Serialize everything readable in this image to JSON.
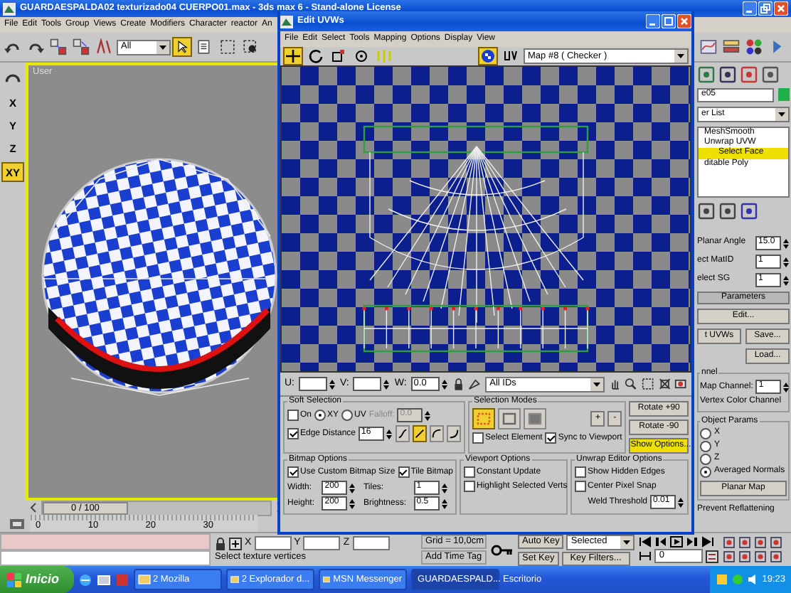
{
  "window": {
    "title": "GUARDAESPALDA02 texturizado04 CUERPO01.max - 3ds max 6 - Stand-alone License"
  },
  "menu": [
    "File",
    "Edit",
    "Tools",
    "Group",
    "Views",
    "Create",
    "Modifiers",
    "Character",
    "reactor",
    "An"
  ],
  "toolbar": {
    "selection_filter": "All",
    "select_tool": {
      "selected": true
    }
  },
  "axis_buttons": [
    {
      "label": "X",
      "selected": false
    },
    {
      "label": "Y",
      "selected": false
    },
    {
      "label": "Z",
      "selected": false
    },
    {
      "label": "XY",
      "selected": true
    }
  ],
  "viewport": {
    "label": "User"
  },
  "uvw_editor": {
    "title": "Edit UVWs",
    "menu": [
      "File",
      "Edit",
      "Select",
      "Tools",
      "Mapping",
      "Options",
      "Display",
      "View"
    ],
    "tools": [
      {
        "kind": "move",
        "selected": true
      },
      {
        "kind": "rotate",
        "selected": false
      },
      {
        "kind": "scale",
        "selected": false
      },
      {
        "kind": "freeform",
        "selected": false
      },
      {
        "kind": "mirror",
        "selected": false
      }
    ],
    "map": "Map #8 ( Checker )",
    "coords": [
      {
        "label": "U:"
      },
      {
        "label": "V:"
      },
      {
        "label": "W:",
        "value": "0.0"
      }
    ],
    "id_filter": "All IDs",
    "soft_selection": {
      "title": "Soft Selection",
      "on": {
        "label": "On",
        "checked": false
      },
      "space": [
        {
          "label": "XY",
          "selected": true
        },
        {
          "label": "UV",
          "selected": false
        }
      ],
      "falloff": {
        "label": "Falloff:",
        "value": "0.0",
        "disabled": true
      },
      "edge_distance": {
        "label": "Edge Distance",
        "checked": true,
        "value": "16"
      },
      "falloff_types": [
        {
          "kind": "smooth",
          "selected": false
        },
        {
          "kind": "linear",
          "selected": true
        },
        {
          "kind": "slow",
          "selected": false
        },
        {
          "kind": "fast",
          "selected": false
        }
      ]
    },
    "selection_modes": {
      "title": "Selection Modes",
      "modes": [
        {
          "kind": "vertex",
          "selected": true
        },
        {
          "kind": "edge",
          "selected": false
        },
        {
          "kind": "face",
          "selected": false
        }
      ],
      "grow": "+",
      "shrink": "-",
      "select_element": {
        "label": "Select Element",
        "checked": false
      },
      "sync": {
        "label": "Sync to Viewport",
        "checked": true
      }
    },
    "rotate_buttons": [
      "Rotate +90",
      "Rotate -90"
    ],
    "show_options": {
      "label": "Show Options...",
      "on": true
    },
    "bitmap_options": {
      "title": "Bitmap Options",
      "custom_size": {
        "label": "Use Custom Bitmap Size",
        "checked": true
      },
      "tile": {
        "label": "Tile Bitmap",
        "checked": true
      },
      "fields": [
        {
          "label": "Width:",
          "value": "200"
        },
        {
          "label": "Tiles:",
          "value": "1"
        },
        {
          "label": "Height:",
          "value": "200"
        },
        {
          "label": "Brightness:",
          "value": "0.5"
        }
      ]
    },
    "viewport_options": {
      "title": "Viewport Options",
      "options": [
        {
          "label": "Constant Update",
          "checked": false
        },
        {
          "label": "Highlight Selected Verts",
          "checked": false
        }
      ]
    },
    "editor_options": {
      "title": "Unwrap Editor Options",
      "options": [
        {
          "label": "Show Hidden Edges",
          "checked": false
        },
        {
          "label": "Center Pixel Snap",
          "checked": false
        }
      ],
      "weld": {
        "label": "Weld Threshold",
        "value": "0.01"
      }
    }
  },
  "command_panel": {
    "object_name": "e05",
    "modifier_list": "er List",
    "stack": [
      {
        "label": "MeshSmooth",
        "selected": false
      },
      {
        "label": "Unwrap UVW",
        "selected": false,
        "children": [
          {
            "label": "Select Face",
            "selected": true
          }
        ]
      },
      {
        "label": "ditable Poly",
        "selected": false
      }
    ],
    "spinners": [
      {
        "label": "Planar Angle",
        "value": "15.0"
      },
      {
        "label": "ect MatID",
        "value": "1"
      },
      {
        "label": "elect SG",
        "value": "1"
      }
    ],
    "parameters_title": "Parameters",
    "edit_button": "Edit...",
    "reset_button": "t UVWs",
    "save_button": "Save...",
    "load_button": "Load...",
    "channel": {
      "title": "nnel",
      "map_channel": {
        "label": "Map Channel:",
        "value": "1"
      },
      "vertex_color": "Vertex Color Channel"
    },
    "object_params": {
      "title": "Object Params",
      "axes": [
        {
          "label": "X",
          "selected": false
        },
        {
          "label": "Y",
          "selected": false
        },
        {
          "label": "Z",
          "selected": false
        },
        {
          "label": "Averaged Normals",
          "selected": true
        }
      ],
      "planar_map": "Planar Map"
    },
    "prevent_reflattening": "Prevent Reflattening"
  },
  "timeline": {
    "position": "0 / 100",
    "ticks": [
      "0",
      "10",
      "20",
      "30"
    ]
  },
  "status": {
    "coords": [
      "X",
      "Y",
      "Z"
    ],
    "prompt": "Select texture vertices",
    "grid": "Grid = 10,0cm",
    "time_tag": "Add Time Tag",
    "auto_key": "Auto Key",
    "key_mode": "Selected",
    "set_key": "Set Key",
    "key_filters": "Key Filters...",
    "frame": "0"
  },
  "taskbar": {
    "start": "Inicio",
    "tasks": [
      {
        "label": "2 Mozilla",
        "selected": false
      },
      {
        "label": "2 Explorador d...",
        "selected": false
      },
      {
        "label": "MSN Messenger",
        "selected": false
      },
      {
        "label": "GUARDAESPALD...",
        "selected": true
      }
    ],
    "desktop_toolbar": "Escritorio",
    "clock": "19:23"
  }
}
